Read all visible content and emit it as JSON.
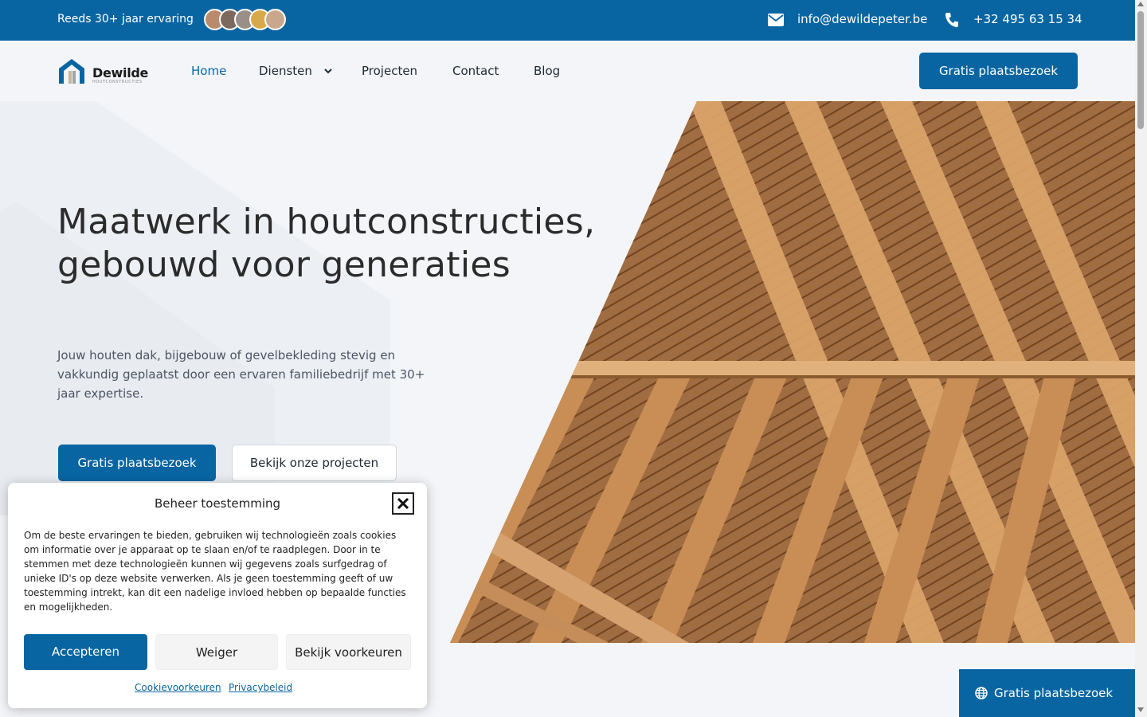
{
  "topbar": {
    "experience": "Reeds 30+ jaar ervaring",
    "avatars": [
      "avatar-1",
      "avatar-2",
      "avatar-3",
      "avatar-4",
      "avatar-5"
    ],
    "email_icon": "envelope-icon",
    "email": "info@dewildepeter.be",
    "phone_icon": "phone-icon",
    "phone": "+32 495 63 15 34"
  },
  "logo": {
    "name": "Dewilde",
    "sub": "HOUTCONSTRUCTIES"
  },
  "nav": {
    "items": [
      {
        "label": "Home",
        "active": true
      },
      {
        "label": "Diensten",
        "has_dropdown": true
      },
      {
        "label": "Projecten"
      },
      {
        "label": "Contact"
      },
      {
        "label": "Blog"
      }
    ],
    "cta": "Gratis plaatsbezoek"
  },
  "hero": {
    "title": "Maatwerk in houtconstructies, gebouwd voor generaties",
    "subtitle": "Jouw houten dak, bijgebouw of gevelbekleding stevig en vakkundig geplaatst door een ervaren familiebedrijf met 30+ jaar expertise.",
    "primary_button": "Gratis plaatsbezoek",
    "secondary_button": "Bekijk onze projecten"
  },
  "cookie": {
    "title": "Beheer toestemming",
    "text": "Om de beste ervaringen te bieden, gebruiken wij technologieën zoals cookies om informatie over je apparaat op te slaan en/of te raadplegen. Door in te stemmen met deze technologieën kunnen wij gegevens zoals surfgedrag of unieke ID's op deze website verwerken. Als je geen toestemming geeft of uw toestemming intrekt, kan dit een nadelige invloed hebben op bepaalde functies en mogelijkheden.",
    "accept": "Accepteren",
    "deny": "Weiger",
    "preferences": "Bekijk voorkeuren",
    "link_cookies": "Cookievoorkeuren",
    "link_privacy": "Privacybeleid"
  },
  "floating_cta": {
    "icon": "globe-icon",
    "label": "Gratis plaatsbezoek"
  },
  "colors": {
    "brand": "#0865a2",
    "background": "#f3f5f9",
    "text_dark": "#2b2b2b"
  }
}
